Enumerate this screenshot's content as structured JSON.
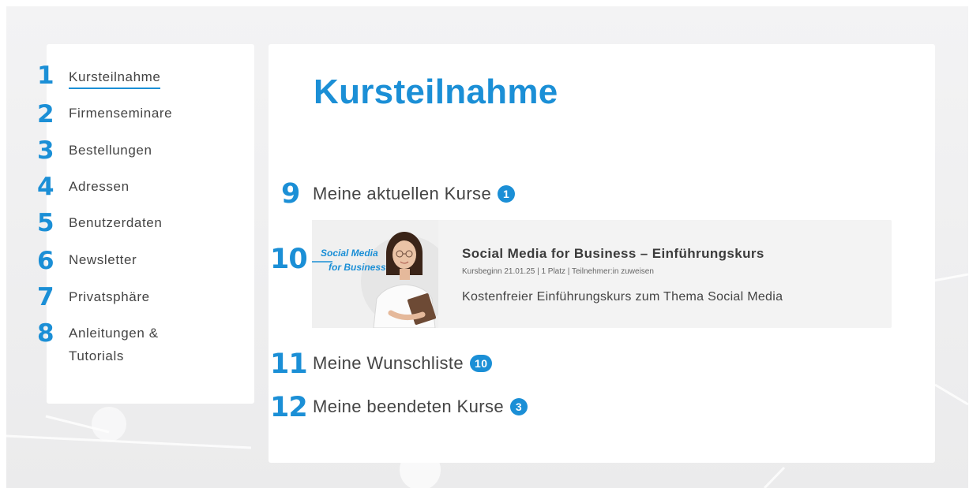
{
  "sidebar": {
    "items": [
      {
        "num": "1",
        "label": "Kursteilnahme",
        "active": true
      },
      {
        "num": "2",
        "label": "Firmenseminare"
      },
      {
        "num": "3",
        "label": "Bestellungen"
      },
      {
        "num": "4",
        "label": "Adressen"
      },
      {
        "num": "5",
        "label": "Benutzerdaten"
      },
      {
        "num": "6",
        "label": "Newsletter"
      },
      {
        "num": "7",
        "label": "Privatsphäre"
      },
      {
        "num": "8",
        "label_line1": "Anleitungen &",
        "label_line2": "Tutorials"
      }
    ]
  },
  "main": {
    "title": "Kursteilnahme",
    "current": {
      "num": "9",
      "title": "Meine aktuellen Kurse",
      "count": "1"
    },
    "course": {
      "num": "10",
      "thumb_line1": "Social Media",
      "thumb_line2": "for Business",
      "title": "Social Media for Business – Einführungskurs",
      "meta": "Kursbeginn 21.01.25 | 1 Platz | Teilnehmer:in zuweisen",
      "description": "Kostenfreier Einführungskurs zum Thema Social Media"
    },
    "wishlist": {
      "num": "11",
      "title": "Meine Wunschliste",
      "count": "10"
    },
    "finished": {
      "num": "12",
      "title": "Meine beendeten Kurse",
      "count": "3"
    }
  },
  "colors": {
    "accent": "#1b8fd6",
    "text": "#444444",
    "card": "#f3f3f3"
  }
}
